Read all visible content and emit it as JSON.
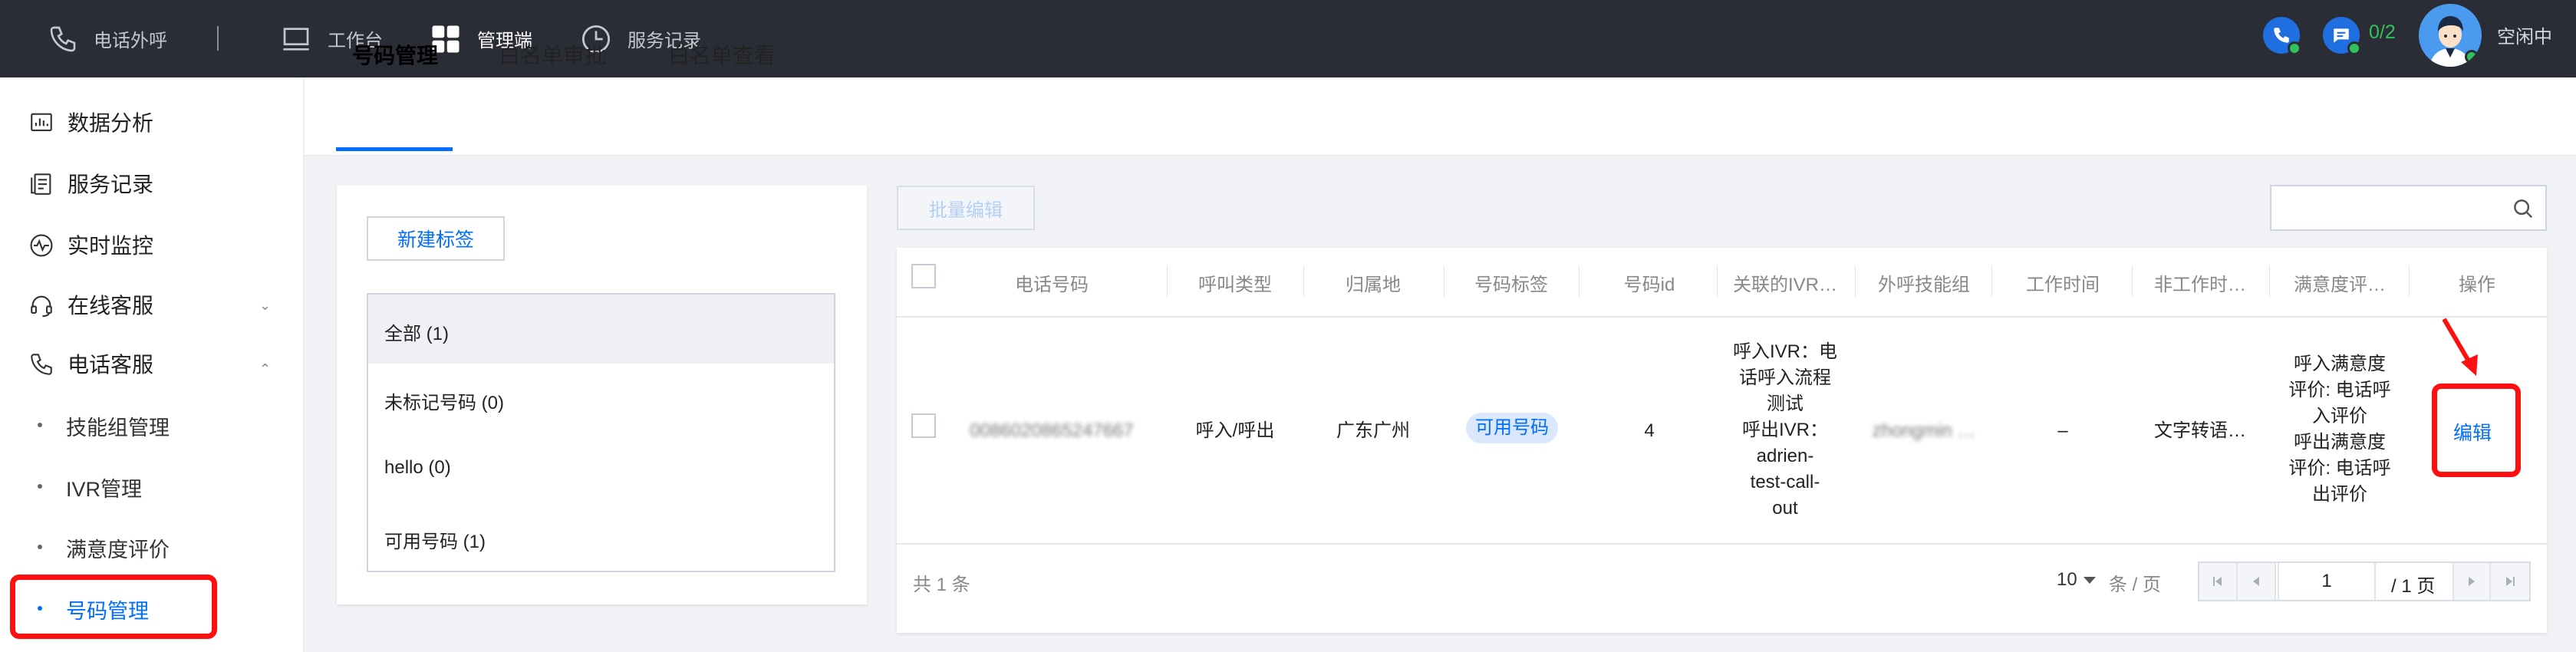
{
  "topbar": {
    "items": [
      {
        "label": "电话外呼",
        "icon": "phone-icon"
      },
      {
        "label": "工作台",
        "icon": "monitor-icon"
      },
      {
        "label": "管理端",
        "icon": "grid-icon"
      },
      {
        "label": "服务记录",
        "icon": "clock-icon"
      }
    ],
    "message_count": "0/2",
    "status": "空闲中"
  },
  "sidebar": {
    "items": [
      {
        "label": "数据分析",
        "icon": "chart-icon"
      },
      {
        "label": "服务记录",
        "icon": "records-icon"
      },
      {
        "label": "实时监控",
        "icon": "monitor-wave-icon"
      },
      {
        "label": "在线客服",
        "icon": "headset-icon"
      },
      {
        "label": "电话客服",
        "icon": "phone-icon"
      }
    ],
    "sub_items": [
      {
        "label": "技能组管理"
      },
      {
        "label": "IVR管理"
      },
      {
        "label": "满意度评价"
      },
      {
        "label": "号码管理"
      }
    ]
  },
  "tabs": [
    {
      "label": "号码管理"
    },
    {
      "label": "白名单审批"
    },
    {
      "label": "白名单查看"
    }
  ],
  "left_panel": {
    "new_tag_button": "新建标签",
    "tags": [
      {
        "label": "全部 (1)"
      },
      {
        "label": "未标记号码 (0)"
      },
      {
        "label": "hello (0)"
      },
      {
        "label": "可用号码 (1)"
      }
    ]
  },
  "toolbar": {
    "batch_edit": "批量编辑",
    "search_placeholder": ""
  },
  "table": {
    "headers": [
      "电话号码",
      "呼叫类型",
      "归属地",
      "号码标签",
      "号码id",
      "关联的IVR…",
      "外呼技能组",
      "工作时间",
      "非工作时…",
      "满意度评…",
      "操作"
    ],
    "row": {
      "phone": "0086020865247667",
      "call_type": "呼入/呼出",
      "location": "广东广州",
      "tag": "可用号码",
      "number_id": "4",
      "ivr": "呼入IVR：电\n话呼入流程\n测试\n呼出IVR：\nadrien-\ntest-call-\nout",
      "skill_group": "zhongmin …",
      "work_time": "–",
      "non_work_time": "文字转语…",
      "satisfaction": "呼入满意度\n评价: 电话呼\n入评价\n呼出满意度\n评价: 电话呼\n出评价",
      "action": "编辑"
    }
  },
  "footer": {
    "total": "共 1 条",
    "page_size": "10",
    "per_page_label": "条 / 页",
    "current_page": "1",
    "total_pages": "/ 1 页"
  },
  "colors": {
    "accent": "#006eff",
    "topbar_bg": "#2a2d36",
    "highlight": "#ff1010",
    "online": "#2fc25b"
  }
}
